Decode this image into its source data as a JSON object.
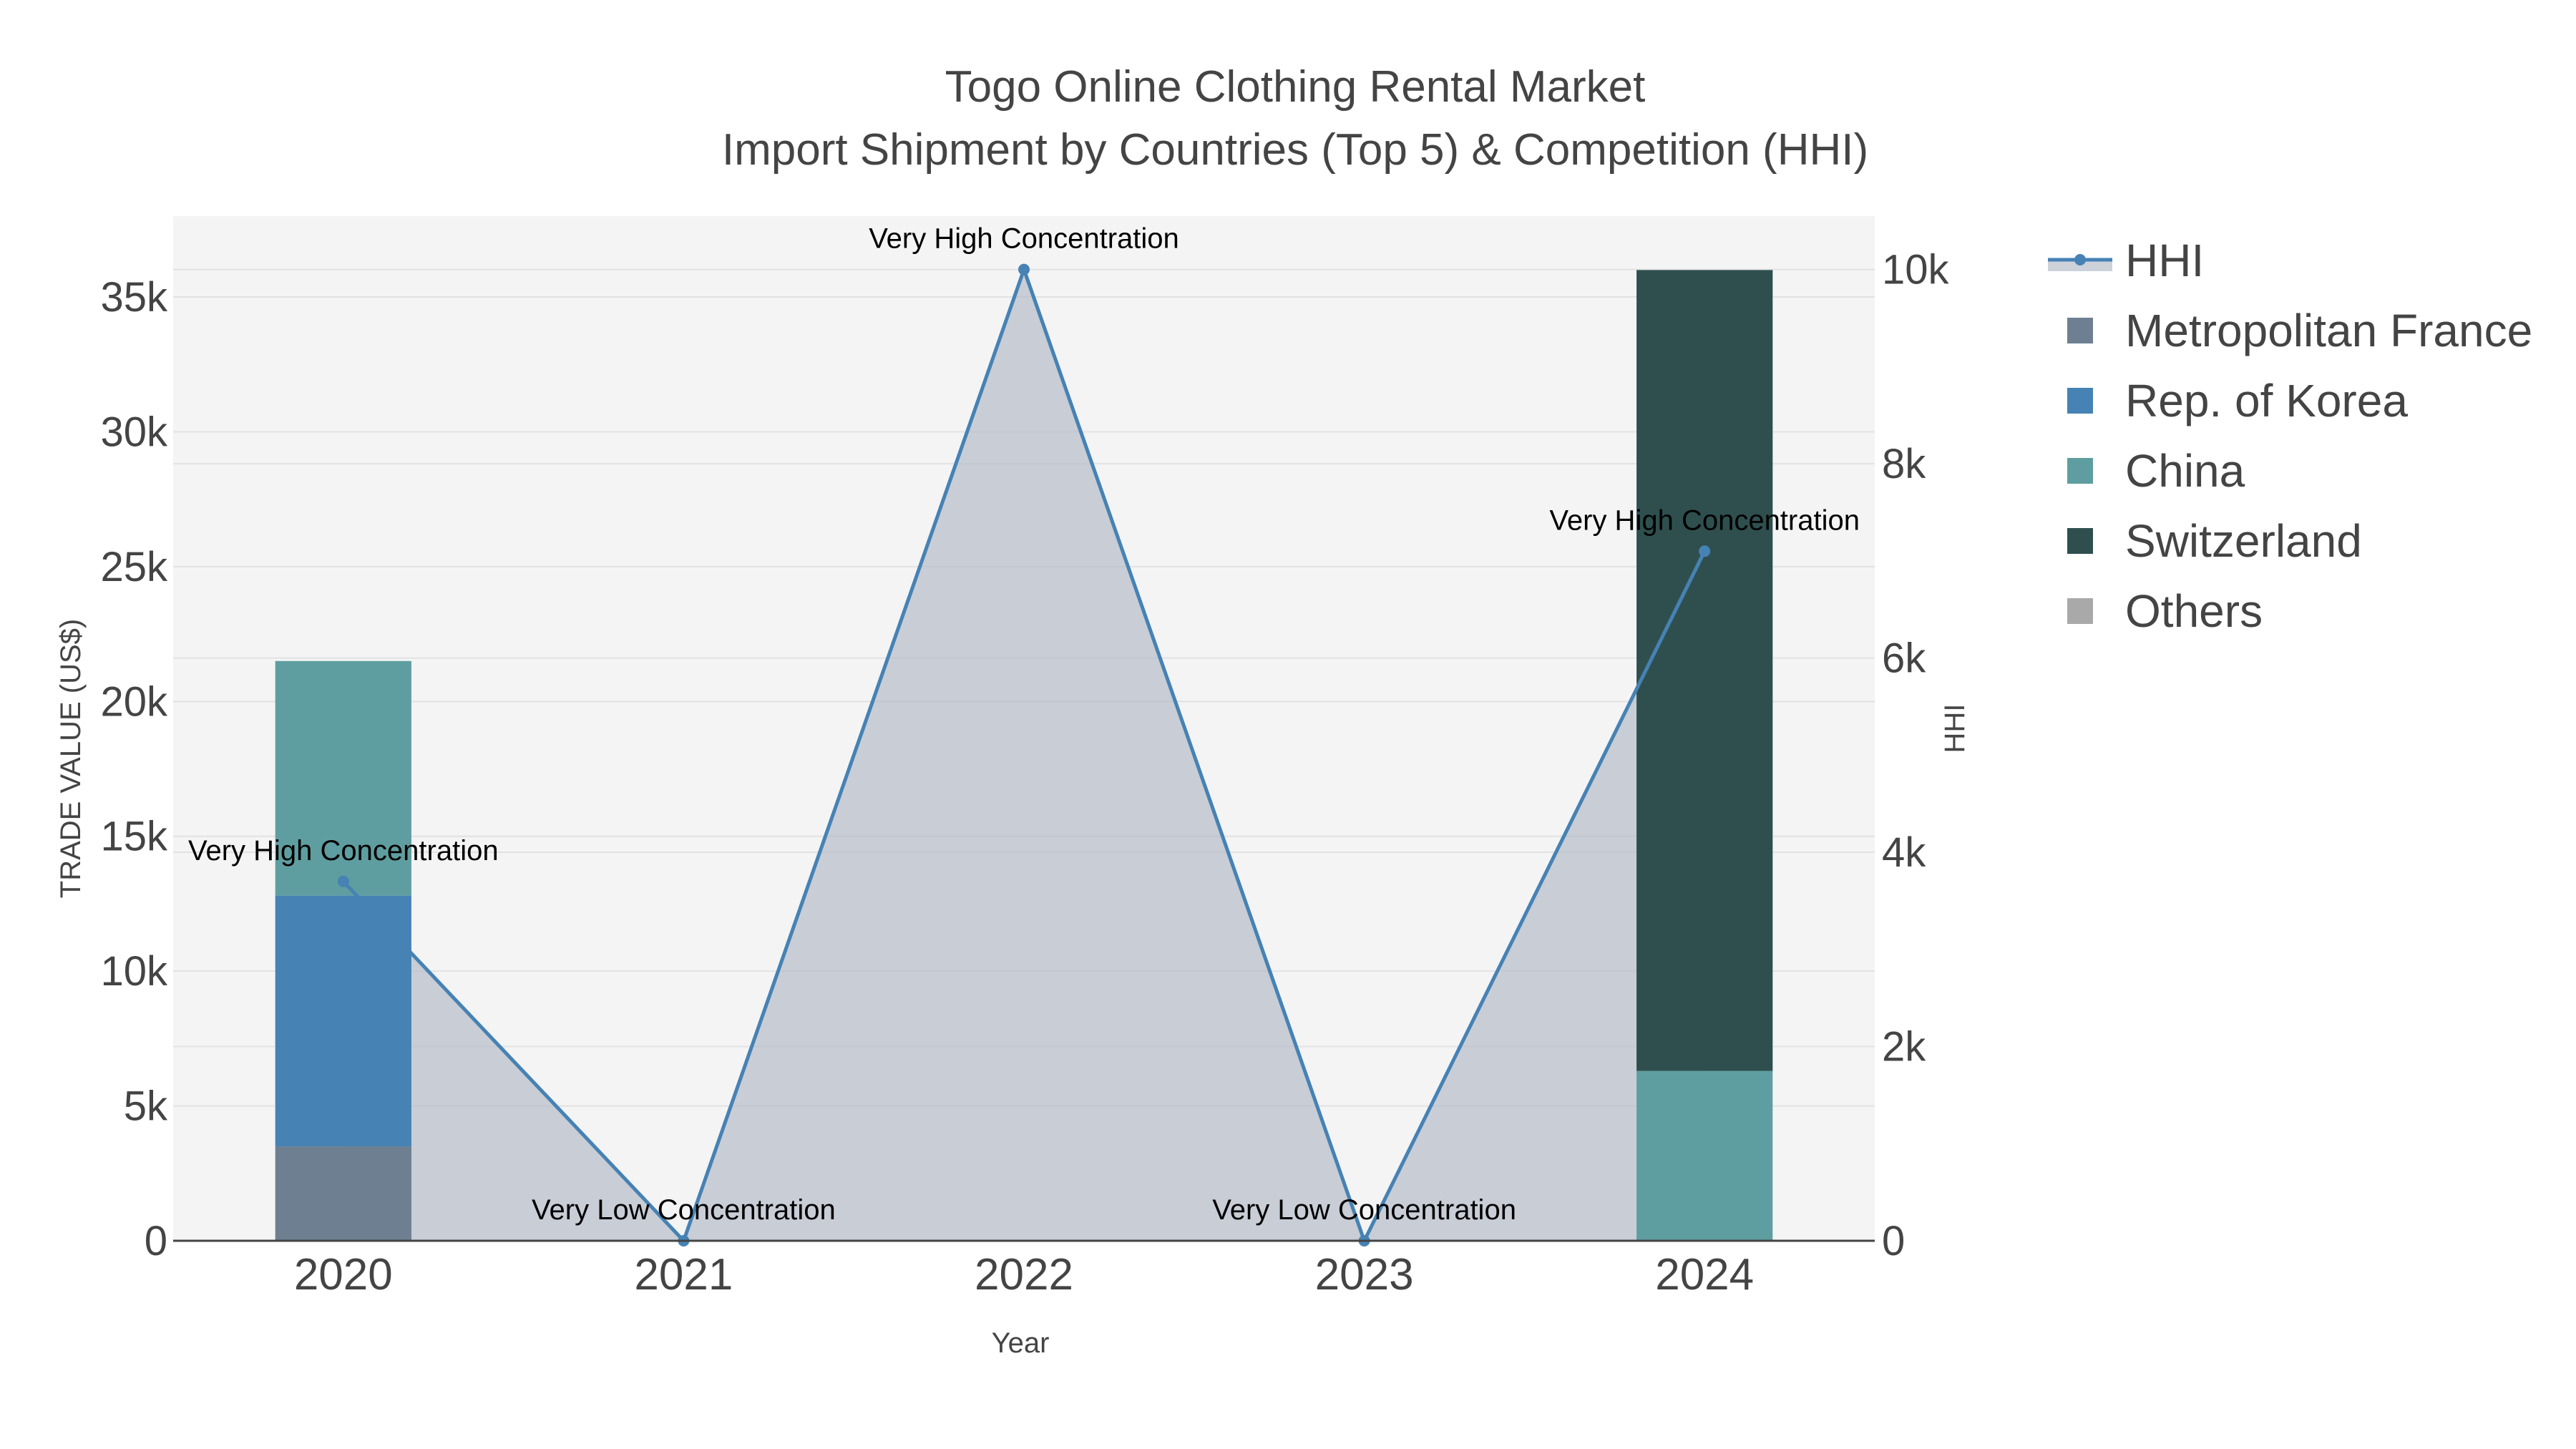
{
  "chart_data": {
    "type": "bar",
    "title": "Togo Online Clothing Rental Market",
    "subtitle": "Import Shipment by Countries (Top 5) & Competition (HHI)",
    "xlabel": "Year",
    "ylabel": "TRADE VALUE (US$)",
    "y2label": "HHI",
    "categories": [
      "2020",
      "2021",
      "2022",
      "2023",
      "2024"
    ],
    "ylim": [
      0,
      38000
    ],
    "y2lim": [
      0,
      10550
    ],
    "yticks": [
      0,
      5000,
      10000,
      15000,
      20000,
      25000,
      30000,
      35000
    ],
    "ytick_labels": [
      "0",
      "5k",
      "10k",
      "15k",
      "20k",
      "25k",
      "30k",
      "35k"
    ],
    "y2ticks": [
      0,
      2000,
      4000,
      6000,
      8000,
      10000
    ],
    "y2tick_labels": [
      "0",
      "2k",
      "4k",
      "6k",
      "8k",
      "10k"
    ],
    "grid": true,
    "legend_position": "right",
    "series": [
      {
        "name": "Metropolitan France",
        "color": "#6e7f91",
        "values": [
          3500,
          0,
          0,
          0,
          0
        ]
      },
      {
        "name": "Rep. of Korea",
        "color": "#4682b4",
        "values": [
          9300,
          0,
          0,
          0,
          0
        ]
      },
      {
        "name": "China",
        "color": "#5f9ea0",
        "values": [
          8700,
          0,
          0,
          0,
          6300
        ]
      },
      {
        "name": "Switzerland",
        "color": "#2f4f4f",
        "values": [
          0,
          0,
          0,
          0,
          29700
        ]
      },
      {
        "name": "Others",
        "color": "#a9a9a9",
        "values": [
          0,
          0,
          0,
          0,
          0
        ]
      }
    ],
    "hhi": {
      "name": "HHI",
      "color": "#4682b4",
      "fill_color": "rgba(176,184,198,0.65)",
      "values": [
        3700,
        0,
        10000,
        0,
        7100
      ],
      "annotations": [
        "Very High Concentration",
        "Very Low Concentration",
        "Very High Concentration",
        "Very Low Concentration",
        "Very High Concentration"
      ]
    }
  }
}
